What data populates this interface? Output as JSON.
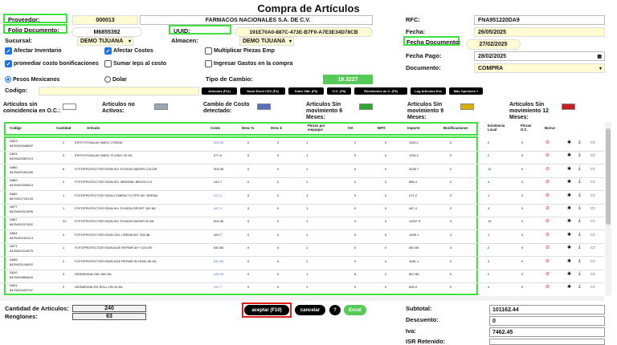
{
  "title": "Compra de Artículos",
  "header": {
    "proveedor_label": "Proveedor:",
    "proveedor_code": "000013",
    "proveedor_name": "FARMACOS NACIONALES S.A. DE C.V.",
    "folio_label": "Folio Documento:",
    "folio_value": "M6855392",
    "uuid_label": "UUID:",
    "uuid_value": "191E70A0-887C-473E-B7F0-A7E3E34D78CB",
    "sucursal_label": "Sucursal:",
    "sucursal_value": "DEMO TIJUANA",
    "almacen_label": "Almacen:",
    "almacen_value": "DEMO TIJUANA",
    "rfc_label": "RFC:",
    "rfc_value": "FNA951220DA9",
    "fecha_label": "Fecha:",
    "fecha_value": "26/05/2025",
    "fecha_doc_label": "Fecha Documento:",
    "fecha_doc_value": "27/02/2025",
    "fecha_pago_label": "Fecha Pago:",
    "fecha_pago_value": "28/02/2025",
    "documento_label": "Documento:",
    "documento_value": "COMPRA"
  },
  "options": {
    "afectar_inventario": "Afectar Inventario",
    "afectar_costos": "Afectar Costos",
    "multiplicar_piezas": "Multiplicar Piezas Emp",
    "promediar": "promediar costo bonificaciones",
    "sumar_ieps": "Sumar Ieps al costo",
    "ingresar_gastos": "Ingresar Gastos en la compra",
    "pesos": "Pesos Mexicanos",
    "dolar": "Dolar",
    "tipo_cambio_label": "Tipo de Cambio:",
    "tipo_cambio_value": "19.3227",
    "codigo_label": "Codigo:"
  },
  "toolbar": [
    "Articulos (F11)",
    "Subir Excel CSV (F4)",
    "Subir XML (F6)",
    "O.C. (F8)",
    "Remisiones de C. (F9)",
    "Log Articulos Exc",
    "Mas Opciones +"
  ],
  "legend": [
    {
      "label": "Articulos sin coincidencia en O.C.:",
      "color": "#ffffff"
    },
    {
      "label": "Articulos no Activos:",
      "color": "#9aa7b5"
    },
    {
      "label": "Cambio de Costo detectado:",
      "color": "#5b6fc0"
    },
    {
      "label": "Articulos Sin movimiento 6 Meses:",
      "color": "#2ea82e"
    },
    {
      "label": "Articulos Sin movimiento 9 Meses:",
      "color": "#d9b100"
    },
    {
      "label": "Articulos Sin movimiento 12 Meses:",
      "color": "#c81e1e"
    }
  ],
  "columns": [
    "Codigo",
    "Cantidad",
    "Articulo",
    "Costo",
    "Desc %",
    "Desc $",
    "Piezas por empaque",
    "IVA",
    "IEPS",
    "Importe",
    "Bonificaciones",
    "Existencia Local",
    "Piezas O.C.",
    "Borrar"
  ],
  "rows": [
    {
      "codigo": "D823",
      "barcode": "8429420048652",
      "cantidad": "2",
      "articulo": "ERYFOTONA AK-NMSC CREMA",
      "costo": "550.00",
      "desc_pct": "0",
      "desc_amt": "0",
      "piezas": "1",
      "iva": "0",
      "ieps": "0",
      "importe": "1100.1",
      "bonif": "0",
      "existencia": "2",
      "piezas_oc": "0",
      "costo_changed": true
    },
    {
      "codigo": "D824",
      "barcode": "8429420062313",
      "cantidad": "3",
      "articulo": "ERYFOTONA AK-NMSC FLUIDO 30 ML",
      "costo": "377.6",
      "desc_pct": "0",
      "desc_amt": "0",
      "piezas": "1",
      "iva": "0",
      "ieps": "0",
      "importe": "1135.2",
      "bonif": "0",
      "existencia": "2",
      "piezas_oc": "0",
      "costo_changed": false
    },
    {
      "codigo": "D860",
      "barcode": "8429420154186",
      "cantidad": "6",
      "articulo": "FOTOPROTECTOR ISDIN 50+ FUSION WATER COLOR",
      "costo": "504.45",
      "desc_pct": "0",
      "desc_amt": "0",
      "piezas": "1",
      "iva": "0",
      "ieps": "0",
      "importe": "3026.7",
      "bonif": "0",
      "existencia": "12",
      "piezas_oc": "0",
      "costo_changed": false
    },
    {
      "codigo": "D869",
      "barcode": "8429420200814",
      "cantidad": "2",
      "articulo": "FOTOPROTECTOR ISDIN 50+ MINERAL BRUSH 2.0",
      "costo": "442.7",
      "desc_pct": "0",
      "desc_amt": "0",
      "piezas": "1",
      "iva": "0",
      "ieps": "0",
      "importe": "885.4",
      "bonif": "0",
      "existencia": "4",
      "piezas_oc": "0",
      "costo_changed": false
    },
    {
      "codigo": "D882",
      "barcode": "8470001716125",
      "cantidad": "1",
      "articulo": "FOTOPROTECTOR ISDIN COMPACTO FPS 50+ ARENA",
      "costo": "471.2",
      "desc_pct": "0",
      "desc_amt": "0",
      "piezas": "1",
      "iva": "0",
      "ieps": "0",
      "importe": "471.2",
      "bonif": "0",
      "existencia": "1",
      "piezas_oc": "0",
      "costo_changed": true
    },
    {
      "codigo": "D877",
      "barcode": "8429420021695",
      "cantidad": "1",
      "articulo": "FOTOPROTECTOR ISDIN 50+ FUSION SPORT 100 ML",
      "costo": "467.4",
      "desc_pct": "0",
      "desc_amt": "0",
      "piezas": "1",
      "iva": "0",
      "ieps": "0",
      "importe": "467.4",
      "bonif": "0",
      "existencia": "4",
      "piezas_oc": "0",
      "costo_changed": true
    },
    {
      "codigo": "D857",
      "barcode": "8429420107602",
      "cantidad": "22",
      "articulo": "FOTOPROTECTOR ISDIN 50+ FUSION WATER 50 ML",
      "costo": "504.45",
      "desc_pct": "0",
      "desc_amt": "0",
      "piezas": "1",
      "iva": "0",
      "ieps": "0",
      "importe": "11097.9",
      "bonif": "0",
      "existencia": "19",
      "piezas_oc": "0",
      "costo_changed": false
    },
    {
      "codigo": "D864",
      "barcode": "8429420161214",
      "cantidad": "3",
      "articulo": "FOTOPROTECTOR ISDIN GEL CREMA 50+ 250 ML",
      "costo": "499.7",
      "desc_pct": "0",
      "desc_amt": "0",
      "piezas": "1",
      "iva": "0",
      "ieps": "0",
      "importe": "1499.1",
      "bonif": "0",
      "existencia": "1",
      "piezas_oc": "0",
      "costo_changed": false
    },
    {
      "codigo": "D871",
      "barcode": "8429420214675",
      "cantidad": "1",
      "articulo": "FOTOPROTECTOR ISDIN AGE REPAIR 50+ COLOR",
      "costo": "540.55",
      "desc_pct": "0",
      "desc_amt": "0",
      "piezas": "1",
      "iva": "0",
      "ieps": "0",
      "importe": "540.55",
      "bonif": "0",
      "existencia": "2",
      "piezas_oc": "0",
      "costo_changed": false
    },
    {
      "codigo": "D859",
      "barcode": "8429420144602",
      "cantidad": "2",
      "articulo": "FOTOPROTECTOR ISDIN AGE REPAIR 50+EMU 50 ML",
      "costo": "540.55",
      "desc_pct": "0",
      "desc_amt": "0",
      "piezas": "1",
      "iva": "0",
      "ieps": "0",
      "importe": "1081.1",
      "bonif": "0",
      "existencia": "3",
      "piezas_oc": "0",
      "costo_changed": true
    },
    {
      "codigo": "D810",
      "barcode": "8470003854649",
      "cantidad": "3",
      "articulo": "GERMISDIN GEL 500 ML",
      "costo": "285.95",
      "desc_pct": "0",
      "desc_amt": "0",
      "piezas": "1",
      "iva": "8",
      "ieps": "0",
      "importe": "857.85",
      "bonif": "0",
      "existencia": "2",
      "piezas_oc": "0",
      "costo_changed": true
    },
    {
      "codigo": "D831",
      "barcode": "8470003429757",
      "cantidad": "2",
      "articulo": "GERMISDIN RX ROLL ON 40 ML",
      "costo": "347.7",
      "desc_pct": "0",
      "desc_amt": "0",
      "piezas": "1",
      "iva": "0",
      "ieps": "0",
      "importe": "695.4",
      "bonif": "0",
      "existencia": "4",
      "piezas_oc": "0",
      "costo_changed": true
    }
  ],
  "footer": {
    "cantidad_label": "Cantidad de Articulos:",
    "cantidad_value": "240",
    "renglones_label": "Renglones:",
    "renglones_value": "63",
    "aceptar": "aceptar (F10)",
    "cancelar": "cancelar",
    "help": "?",
    "excel": "Excel",
    "subtotal_label": "Subtotal:",
    "subtotal_value": "101162.44",
    "descuento_label": "Descuento:",
    "descuento_value": "0",
    "iva_label": "Iva:",
    "iva_value": "7462.45",
    "isr_label": "ISR Retenido:"
  },
  "colors": {
    "green_highlight": "#3ee23e",
    "yellow_field": "#fffbd3",
    "red_highlight": "#e11d1d",
    "excel_green": "#57c957",
    "costo_blue": "#5b6fc0"
  }
}
